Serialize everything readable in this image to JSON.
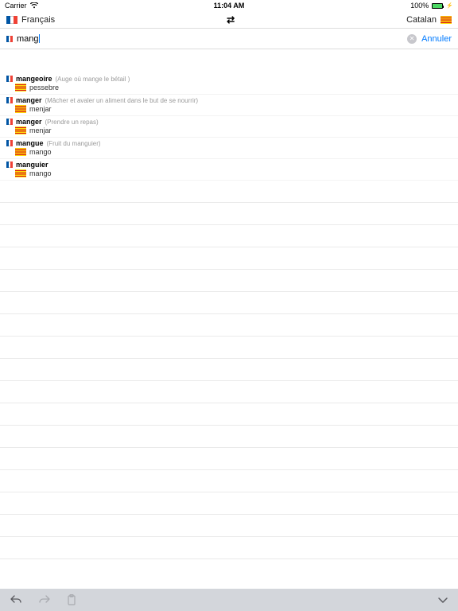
{
  "status": {
    "carrier": "Carrier",
    "time": "11:04 AM",
    "battery": "100%"
  },
  "header": {
    "src_lang": "Français",
    "dst_lang": "Catalan"
  },
  "search": {
    "value": "mang",
    "cancel": "Annuler"
  },
  "results": [
    {
      "src": "mangeoire",
      "hint": "(Auge où mange le bétail )",
      "dst": "pessebre"
    },
    {
      "src": "manger",
      "hint": "(Mâcher et avaler un aliment dans le but de se nourrir)",
      "dst": "menjar"
    },
    {
      "src": "manger",
      "hint": "(Prendre un repas)",
      "dst": "menjar"
    },
    {
      "src": "mangue",
      "hint": "(Fruit du manguier)",
      "dst": "mango"
    },
    {
      "src": "manguier",
      "hint": "",
      "dst": "mango"
    }
  ]
}
